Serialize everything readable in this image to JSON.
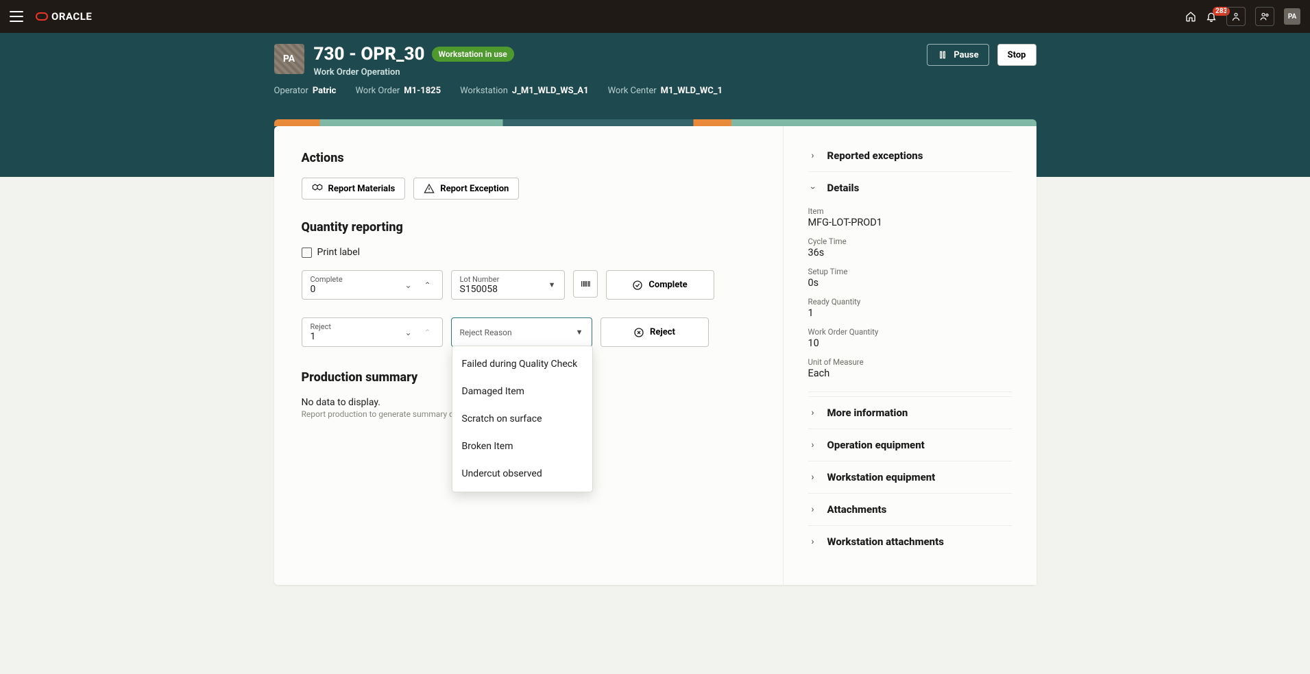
{
  "topbar": {
    "brand": "ORACLE",
    "notif_count": "283",
    "avatar_initials": "PA"
  },
  "hero": {
    "avatar_initials": "PA",
    "title": "730 - OPR_30",
    "badge": "Workstation in use",
    "subtitle": "Work Order Operation",
    "pause_label": "Pause",
    "stop_label": "Stop",
    "meta": {
      "operator_lbl": "Operator",
      "operator_val": "Patric",
      "wo_lbl": "Work Order",
      "wo_val": "M1-1825",
      "ws_lbl": "Workstation",
      "ws_val": "J_M1_WLD_WS_A1",
      "wc_lbl": "Work Center",
      "wc_val": "M1_WLD_WC_1"
    }
  },
  "main": {
    "actions_heading": "Actions",
    "report_materials": "Report Materials",
    "report_exception": "Report Exception",
    "qty_heading": "Quantity reporting",
    "print_label": "Print label",
    "complete_field_label": "Complete",
    "complete_value": "0",
    "lot_label": "Lot Number",
    "lot_value": "S150058",
    "complete_btn": "Complete",
    "reject_field_label": "Reject",
    "reject_value": "1",
    "reject_reason_label": "Reject Reason",
    "reject_btn": "Reject",
    "reject_reasons": [
      "Failed during Quality Check",
      "Damaged Item",
      "Scratch on surface",
      "Broken Item",
      "Undercut observed"
    ],
    "prod_sum_heading": "Production summary",
    "prod_sum_empty_title": "No data to display.",
    "prod_sum_empty_hint": "Report production to generate summary data"
  },
  "side": {
    "reported_exceptions": "Reported exceptions",
    "details": "Details",
    "item_lbl": "Item",
    "item_val": "MFG-LOT-PROD1",
    "cycle_lbl": "Cycle Time",
    "cycle_val": "36s",
    "setup_lbl": "Setup Time",
    "setup_val": "0s",
    "ready_lbl": "Ready Quantity",
    "ready_val": "1",
    "woqty_lbl": "Work Order Quantity",
    "woqty_val": "10",
    "uom_lbl": "Unit of Measure",
    "uom_val": "Each",
    "more_info": "More information",
    "op_equip": "Operation equipment",
    "ws_equip": "Workstation equipment",
    "attachments": "Attachments",
    "ws_attachments": "Workstation attachments"
  }
}
